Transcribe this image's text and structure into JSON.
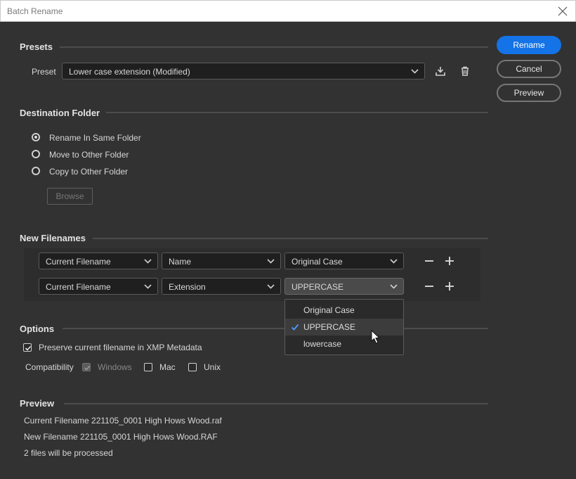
{
  "window": {
    "title": "Batch Rename"
  },
  "buttons": {
    "rename": "Rename",
    "cancel": "Cancel",
    "preview": "Preview",
    "browse": "Browse"
  },
  "presets": {
    "heading": "Presets",
    "label": "Preset",
    "selected": "Lower case extension (Modified)"
  },
  "destination": {
    "heading": "Destination Folder",
    "options": [
      "Rename In Same Folder",
      "Move to Other Folder",
      "Copy to Other Folder"
    ],
    "selected_index": 0
  },
  "new_filenames": {
    "heading": "New Filenames",
    "rows": [
      {
        "source": "Current Filename",
        "part": "Name",
        "case": "Original Case"
      },
      {
        "source": "Current Filename",
        "part": "Extension",
        "case": "UPPERCASE"
      }
    ]
  },
  "case_menu": {
    "options": [
      "Original Case",
      "UPPERCASE",
      "lowercase"
    ],
    "selected": "UPPERCASE"
  },
  "options": {
    "heading": "Options",
    "preserve_label": "Preserve current filename in XMP Metadata",
    "preserve_checked": true,
    "compatibility_label": "Compatibility",
    "compat": [
      {
        "label": "Windows",
        "checked": true,
        "disabled": true
      },
      {
        "label": "Mac",
        "checked": false,
        "disabled": false
      },
      {
        "label": "Unix",
        "checked": false,
        "disabled": false
      }
    ]
  },
  "preview": {
    "heading": "Preview",
    "current": "Current Filename 221105_0001 High Hows Wood.raf",
    "new": "New Filename 221105_0001 High Hows Wood.RAF",
    "count": "2 files will be processed"
  },
  "colors": {
    "accent": "#1473e6",
    "background": "#323232",
    "field": "#1f1f1f"
  }
}
